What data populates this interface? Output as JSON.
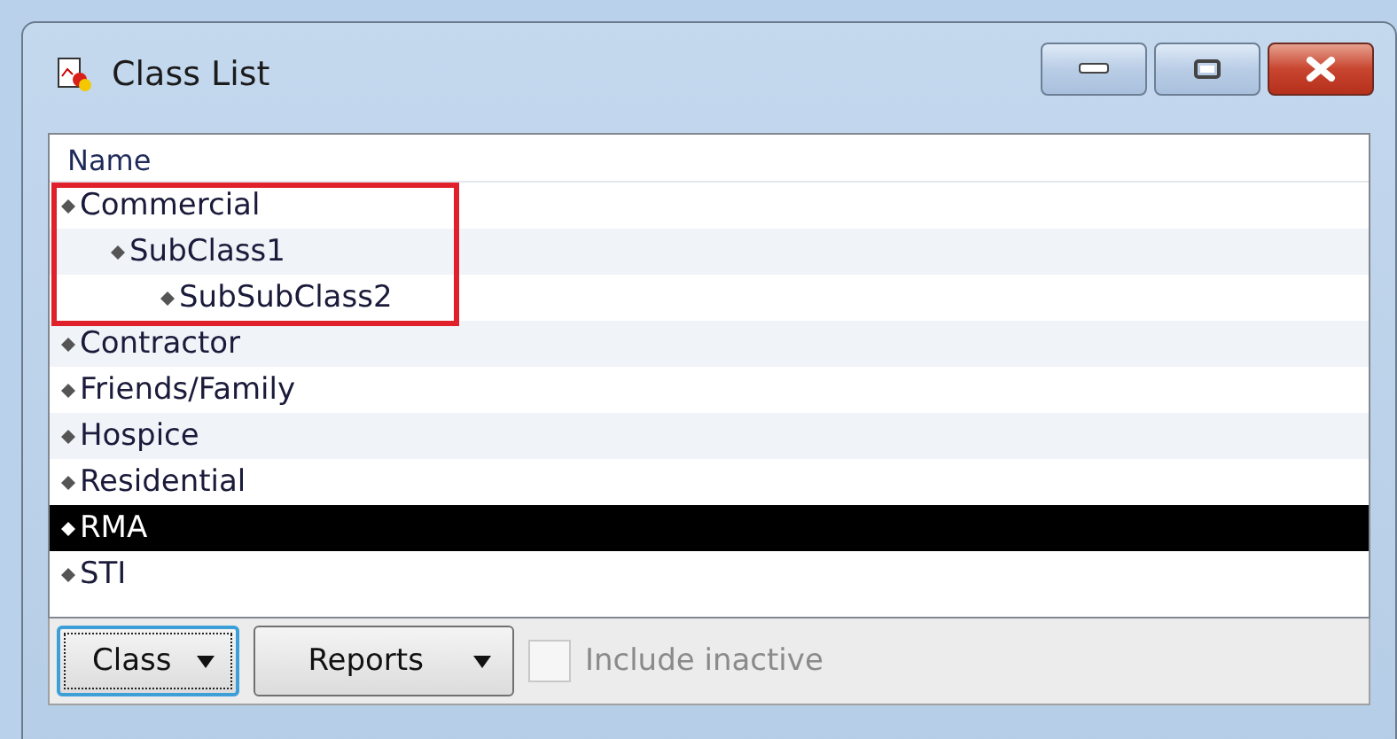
{
  "window": {
    "title": "Class List"
  },
  "list": {
    "column": "Name",
    "items": [
      {
        "label": "Commercial",
        "selected": false,
        "highlighted": true,
        "children": [
          {
            "label": "SubClass1",
            "selected": false,
            "highlighted": true,
            "children": [
              {
                "label": "SubSubClass2",
                "selected": false,
                "highlighted": true
              }
            ]
          }
        ]
      },
      {
        "label": "Contractor",
        "selected": false,
        "highlighted": false
      },
      {
        "label": "Friends/Family",
        "selected": false,
        "highlighted": false
      },
      {
        "label": "Hospice",
        "selected": false,
        "highlighted": false
      },
      {
        "label": "Residential",
        "selected": false,
        "highlighted": false
      },
      {
        "label": "RMA",
        "selected": true,
        "highlighted": false
      },
      {
        "label": "STI",
        "selected": false,
        "highlighted": false
      }
    ]
  },
  "buttons": [
    {
      "label": "Class",
      "focused": true
    },
    {
      "label": "Reports",
      "focused": false
    }
  ],
  "include_inactive": {
    "label": "Include inactive",
    "checked": false,
    "disabled": true
  }
}
